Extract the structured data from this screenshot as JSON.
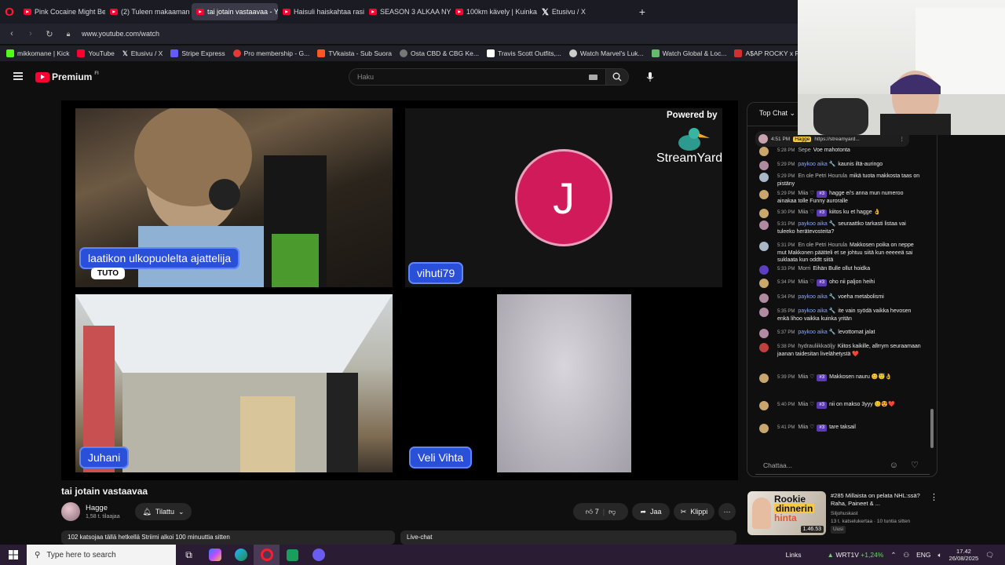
{
  "browser": {
    "tabs": [
      {
        "label": "Pink Cocaine Might Be Th",
        "icon": "youtube-favicon",
        "active": false
      },
      {
        "label": "(2) Tuleen makaaman - Y",
        "icon": "youtube-favicon",
        "active": false
      },
      {
        "label": "tai jotain vastaavaa - You",
        "icon": "youtube-favicon",
        "active": true
      },
      {
        "label": "Haisuli haiskahtaa rasism",
        "icon": "youtube-favicon",
        "active": false
      },
      {
        "label": "SEASON 3 ALKAA NYT! M",
        "icon": "youtube-favicon",
        "active": false
      },
      {
        "label": "100km kävely | Kuinka m",
        "icon": "youtube-favicon",
        "active": false
      },
      {
        "label": "Etusivu / X",
        "icon": "x-favicon",
        "active": false
      }
    ],
    "url": "www.youtube.com/watch",
    "bookmarks": [
      {
        "label": "mikkomane | Kick",
        "color": "#53fc18"
      },
      {
        "label": "YouTube",
        "color": "#ff0033"
      },
      {
        "label": "Etusivu / X",
        "color": "#000000"
      },
      {
        "label": "Stripe Express",
        "color": "#635bff"
      },
      {
        "label": "Pro membership - G...",
        "color": "#e53935"
      },
      {
        "label": "TVkaista - Sub Suora",
        "color": "#ff5722"
      },
      {
        "label": "Osta CBD & CBG Ke...",
        "color": "#777777"
      },
      {
        "label": "Travis Scott Outfits,...",
        "color": "#ffffff"
      },
      {
        "label": "Watch Marvel's Luk...",
        "color": "#cccccc"
      },
      {
        "label": "Watch Global & Loc...",
        "color": "#66bb6a"
      },
      {
        "label": "A$AP ROCKY x PU...",
        "color": "#d32f2f"
      },
      {
        "label": "deceive",
        "color": "#bbbbbb"
      }
    ]
  },
  "youtube": {
    "logo_text": "Premium",
    "logo_region": "FI",
    "search_placeholder": "Haku"
  },
  "video": {
    "powered_by": "Powered by",
    "streamyard": "StreamYard",
    "participants": {
      "top_left_name": "laatikon ulkopuolelta ajattelija",
      "top_left_sub": "TUTO",
      "top_right_initial": "J",
      "top_right_name": "vihuti79",
      "bottom_left_name": "Juhani",
      "bottom_right_name": "Veli Vihta"
    }
  },
  "below": {
    "title": "tai jotain vastaavaa",
    "channel": "Hagge",
    "subscribers": "1,58 t. tilaajaa",
    "subscribed_label": "Tilattu",
    "likes": "7",
    "share_label": "Jaa",
    "clip_label": "Klippi",
    "description": "102 katsojaa tällä hetkellä  Striimi alkoi 100 minuuttia sitten",
    "live_chat_label": "Live-chat"
  },
  "chat": {
    "mode_label": "Top Chat",
    "pinned_time": "4:51 PM",
    "pinned_author": "Hagge",
    "pinned_text": "https://streamyard...",
    "input_placeholder": "Chattaa...",
    "messages": [
      {
        "time": "5:28 PM",
        "author": "Sepe",
        "text": "Voe mahotonta",
        "badge": "",
        "color": "#c9a66b",
        "blue": false
      },
      {
        "time": "5:29 PM",
        "author": "paykoo aika 🔧",
        "text": "kaunis iltä-auringo",
        "badge": "",
        "color": "#b08aa0",
        "blue": true
      },
      {
        "time": "5:29 PM",
        "author": "En ole Petri Hourula",
        "text": "mikä tuota makkosta taas on pistäny",
        "badge": "",
        "color": "#a6b8c8",
        "blue": false
      },
      {
        "time": "5:29 PM",
        "author": "Miia ♡",
        "text": "hagge ei's anna mun numeroo ainakaa tolle Funny auroralle",
        "badge": "#3",
        "color": "#c9a66b",
        "blue": false
      },
      {
        "time": "5:30 PM",
        "author": "Miia ♡",
        "text": "kiitos ku et hagge 👌",
        "badge": "#3",
        "color": "#c9a66b",
        "blue": false
      },
      {
        "time": "5:31 PM",
        "author": "paykoo aika 🔧",
        "text": "seuraattko tarkasti listaa vai tuleeko herätevosteita?",
        "badge": "",
        "color": "#b08aa0",
        "blue": true
      },
      {
        "time": "5:31 PM",
        "author": "En ole Petri Hourula",
        "text": "Makkosen poika on neppe mut Makkonen päätteli et se johtuu siitä kun eeeeeä sai suklaata kun oddtt siitä",
        "badge": "",
        "color": "#a6b8c8",
        "blue": false
      },
      {
        "time": "5:33 PM",
        "author": "Morri",
        "text": "Eihän Bulle ollut hoidka",
        "badge": "",
        "color": "#5a3fc0",
        "blue": false
      },
      {
        "time": "5:34 PM",
        "author": "Miia ♡",
        "text": "oho nii paljon heihi",
        "badge": "#3",
        "color": "#c9a66b",
        "blue": false
      },
      {
        "time": "5:34 PM",
        "author": "paykoo aika 🔧",
        "text": "voeha metabolismi",
        "badge": "",
        "color": "#b08aa0",
        "blue": true
      },
      {
        "time": "5:35 PM",
        "author": "paykoo aika 🔧",
        "text": "ite vain syödä vaikka hevosen enkä lihoo vaikka kuinka yritän",
        "badge": "",
        "color": "#b08aa0",
        "blue": true
      },
      {
        "time": "5:37 PM",
        "author": "paykoo aika 🔧",
        "text": "levottomat jalat",
        "badge": "",
        "color": "#b08aa0",
        "blue": true
      },
      {
        "time": "5:38 PM",
        "author": "hydrauliikkaöljy",
        "text": "Kiitos kaikille, allrrym seuraamaan jaanan taidesitan livelähetystä ❤️",
        "badge": "",
        "color": "#c04040",
        "blue": false
      },
      {
        "time": "5:39 PM",
        "author": "Miia ♡",
        "text": "Makkosen nauru 😊😇👌",
        "badge": "#3",
        "color": "#c9a66b",
        "blue": false
      },
      {
        "time": "5:40 PM",
        "author": "Miia ♡",
        "text": "nii on makso 3yyy 😊😍❤️",
        "badge": "#3",
        "color": "#c9a66b",
        "blue": false
      },
      {
        "time": "5:41 PM",
        "author": "Miia ♡",
        "text": "tare taksail",
        "badge": "#3",
        "color": "#c9a66b",
        "blue": false
      }
    ]
  },
  "suggestion": {
    "title": "#285 Millaista on pelata NHL:ssä? Raha, Paineet & ...",
    "channel": "Siljohuskast",
    "meta": "13 t. katselukertaa · 10 tuntia sitten",
    "new_label": "Uusi",
    "thumb_text_1": "Rookie",
    "thumb_text_2": "dinnerin",
    "thumb_text_3": "hinta",
    "duration": "1.46.53"
  },
  "taskbar": {
    "search_placeholder": "Type here to search",
    "links_label": "Links",
    "stock_ticker": "WRT1V",
    "stock_change": "+1,24%",
    "lang": "ENG",
    "time": "17.42",
    "date": "26/08/2025"
  }
}
